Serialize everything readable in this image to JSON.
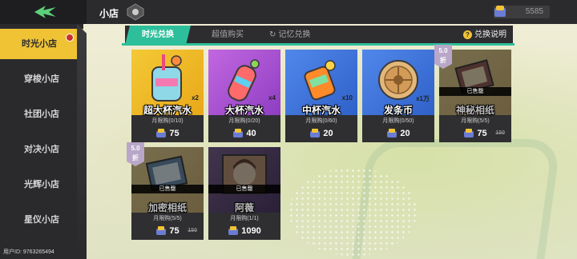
{
  "header": {
    "title": "小店",
    "currency_value": "5585"
  },
  "sidebar": {
    "items": [
      {
        "label": "时光小店",
        "active": true
      },
      {
        "label": "穿梭小店"
      },
      {
        "label": "社团小店"
      },
      {
        "label": "对决小店"
      },
      {
        "label": "光辉小店"
      },
      {
        "label": "星仪小店"
      }
    ],
    "uid": "用户ID: 9763265494"
  },
  "tabs": {
    "items": [
      {
        "label": "时光兑换",
        "active": true
      },
      {
        "label": "超值购买"
      },
      {
        "label": "记忆兑换"
      }
    ],
    "help_label": "兑换说明"
  },
  "cards": [
    {
      "name": "超大杯汽水",
      "qty": "x2",
      "limit": "月限购(0/10)",
      "price": "75",
      "colors": [
        "#f2c431",
        "#e8a519"
      ]
    },
    {
      "name": "大杯汽水",
      "qty": "x4",
      "limit": "月限购(0/20)",
      "price": "40",
      "colors": [
        "#b35ad8",
        "#8c3bc0"
      ]
    },
    {
      "name": "中杯汽水",
      "qty": "x10",
      "limit": "月限购(0/60)",
      "price": "20",
      "colors": [
        "#4a7ee6",
        "#2e5fc8"
      ]
    },
    {
      "name": "发条币",
      "qty": "x1万",
      "limit": "月限购(0/50)",
      "price": "20",
      "colors": [
        "#4a7ee6",
        "#2e5fc8"
      ]
    },
    {
      "name": "神秘相纸",
      "sold": "已售罄",
      "limit": "月限购(5/5)",
      "price": "75",
      "old_price": "150",
      "discount": "5.0\n折",
      "colors": [
        "#f2c431",
        "#e8a519"
      ]
    },
    {
      "name": "加密相纸",
      "sold": "已售罄",
      "limit": "月限购(5/5)",
      "price": "75",
      "old_price": "150",
      "discount": "5.0\n折",
      "colors": [
        "#f2c431",
        "#e8a519"
      ]
    },
    {
      "name": "阿薇",
      "sold": "已售罄",
      "limit": "月限购(1/1)",
      "price": "1090",
      "colors": [
        "#7c49b8",
        "#5b2f98"
      ]
    }
  ]
}
